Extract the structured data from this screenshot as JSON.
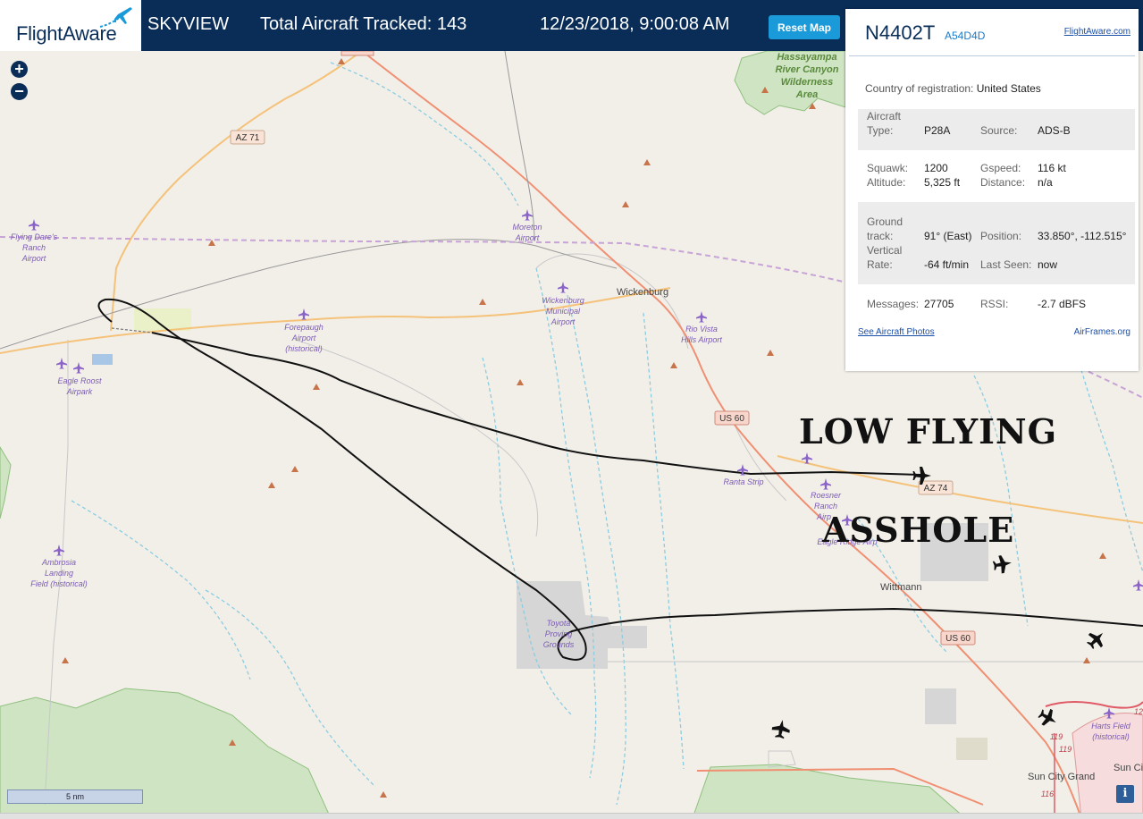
{
  "header": {
    "logo_text": "FlightAware",
    "product": "SKYVIEW",
    "total_label": "Total Aircraft Tracked: 143",
    "datetime": "12/23/2018, 9:00:08 AM",
    "reset_label": "Reset Map"
  },
  "zoom": {
    "in": "+",
    "out": "−"
  },
  "panel": {
    "registration": "N4402T",
    "hex": "A54D4D",
    "flightaware_link": "FlightAware.com",
    "country_label": "Country of registration:",
    "country": "United States",
    "aircraft_type_label": "Aircraft Type:",
    "aircraft_type": "P28A",
    "source_label": "Source:",
    "source": "ADS-B",
    "squawk_label": "Squawk:",
    "squawk": "1200",
    "altitude_label": "Altitude:",
    "altitude": "5,325 ft",
    "gspeed_label": "Gspeed:",
    "gspeed": "116 kt",
    "distance_label": "Distance:",
    "distance": "n/a",
    "ground_track_label": "Ground track:",
    "ground_track": "91° (East)",
    "position_label": "Position:",
    "position": "33.850°, -112.515°",
    "vertical_rate_label": "Vertical Rate:",
    "vertical_rate": "-64 ft/min",
    "last_seen_label": "Last Seen:",
    "last_seen": "now",
    "messages_label": "Messages:",
    "messages": "27705",
    "rssi_label": "RSSI:",
    "rssi": "-2.7 dBFS",
    "photos_link": "See Aircraft Photos",
    "airframes_link": "AirFrames.org"
  },
  "overlay": {
    "line1": "LOW FLYING",
    "line2": "ASSHOLE"
  },
  "map": {
    "places": {
      "flying_dare": [
        "Flying Dare's",
        "Ranch",
        "Airport"
      ],
      "eagle_roost": [
        "Eagle Roost",
        "Airpark"
      ],
      "forepaugh": [
        "Forepaugh",
        "Airport",
        "(historical)"
      ],
      "moreton": [
        "Moreton",
        "Airport"
      ],
      "wickenburg_muni": [
        "Wickenburg",
        "Municipal",
        "Airport"
      ],
      "wickenburg": "Wickenburg",
      "rio_vista": [
        "Rio Vista",
        "Hills Airport"
      ],
      "ranta": "Ranta Strip",
      "roesner": [
        "Roesner",
        "Ranch",
        "Airp"
      ],
      "eagle_ridge": "Eagle Ridge Airp",
      "wittmann": "Wittmann",
      "ambrosia": [
        "Ambrosia",
        "Landing",
        "Field (historical)"
      ],
      "toyota": [
        "Toyota",
        "Proving",
        "Grounds"
      ],
      "hassayampa": [
        "Hassayampa",
        "River Canyon",
        "Wilderness",
        "Area"
      ],
      "harts": [
        "Harts Field",
        "(historical)"
      ],
      "sun_city_grand": "Sun City Grand",
      "sun_city_partial": "Sun Ci"
    },
    "shields": {
      "az71": "AZ 71",
      "us60_a": "US 60",
      "az74": "AZ 74",
      "us60_b": "US 60"
    },
    "route_numbers": [
      "119",
      "119",
      "116",
      "12"
    ],
    "scale": "5 nm",
    "info": "i"
  }
}
